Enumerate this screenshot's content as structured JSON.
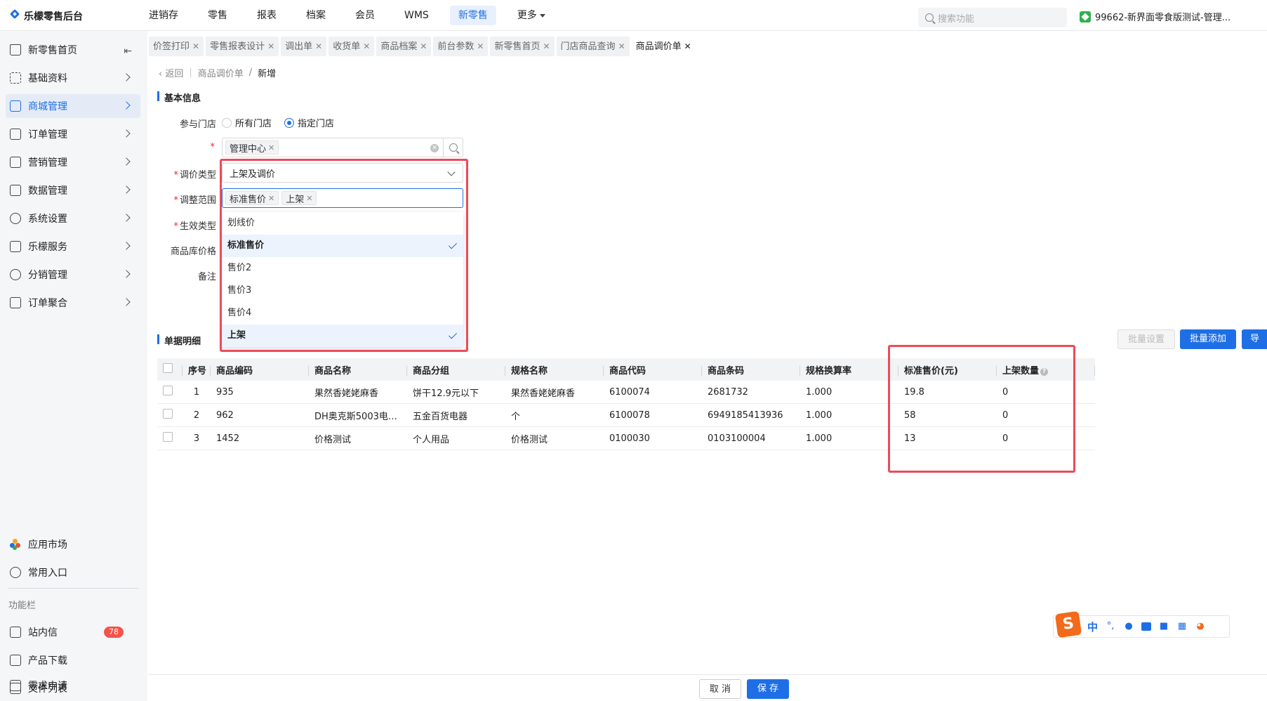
{
  "app": {
    "title": "乐檬零售后台"
  },
  "topnav": {
    "items": [
      "进销存",
      "零售",
      "报表",
      "档案",
      "会员",
      "WMS",
      "新零售"
    ],
    "more_label": "更多",
    "search_placeholder": "搜索功能",
    "store_label": "99662-新界面零食版测试-管理..."
  },
  "sidebar": {
    "items": [
      {
        "label": "新零售首页"
      },
      {
        "label": "基础资料"
      },
      {
        "label": "商城管理"
      },
      {
        "label": "订单管理"
      },
      {
        "label": "营销管理"
      },
      {
        "label": "数据管理"
      },
      {
        "label": "系统设置"
      },
      {
        "label": "乐檬服务"
      },
      {
        "label": "分销管理"
      },
      {
        "label": "订单聚合"
      }
    ],
    "bottom": {
      "app_market": "应用市场",
      "common_entry": "常用入口",
      "section_label": "功能栏",
      "inbox": "站内信",
      "inbox_badge": "78",
      "download": "产品下载",
      "files": "文件列表",
      "requests": "需求申请"
    }
  },
  "tabs": [
    {
      "label": "价签打印"
    },
    {
      "label": "零售报表设计"
    },
    {
      "label": "调出单"
    },
    {
      "label": "收货单"
    },
    {
      "label": "商品档案"
    },
    {
      "label": "前台参数"
    },
    {
      "label": "新零售首页"
    },
    {
      "label": "门店商品查询"
    },
    {
      "label": "商品调价单"
    }
  ],
  "breadcrumb": {
    "back": "返回",
    "parent": "商品调价单",
    "sep": "/",
    "current": "新增"
  },
  "basic_info": {
    "title": "基本信息",
    "store_label": "参与门店",
    "store_options": [
      "所有门店",
      "指定门店"
    ],
    "store_tag": "管理中心",
    "adjust_type_label": "调价类型",
    "adjust_type_value": "上架及调价",
    "range_label": "调整范围",
    "range_tags": [
      "标准售价",
      "上架"
    ],
    "effective_label": "生效类型",
    "price_label": "商品库价格",
    "note_label": "备注"
  },
  "dropdown": {
    "options": [
      {
        "label": "划线价",
        "selected": false
      },
      {
        "label": "标准售价",
        "selected": true
      },
      {
        "label": "售价2",
        "selected": false
      },
      {
        "label": "售价3",
        "selected": false
      },
      {
        "label": "售价4",
        "selected": false
      },
      {
        "label": "上架",
        "selected": true
      }
    ]
  },
  "details": {
    "title": "单据明细",
    "batch_set": "批量设置",
    "batch_add": "批量添加",
    "import": "导入",
    "columns": [
      "序号",
      "商品编码",
      "商品名称",
      "商品分组",
      "规格名称",
      "商品代码",
      "商品条码",
      "规格换算率",
      "标准售价(元)",
      "上架数量"
    ],
    "rows": [
      [
        "1",
        "935",
        "果然香姥姥麻香",
        "饼干12.9元以下",
        "果然香姥姥麻香",
        "6100074",
        "2681732",
        "1.000",
        "19.8",
        "0"
      ],
      [
        "2",
        "962",
        "DH奥克斯5003电…",
        "五金百货电器",
        "个",
        "6100078",
        "6949185413936",
        "1.000",
        "58",
        "0"
      ],
      [
        "3",
        "1452",
        "价格测试",
        "个人用品",
        "价格测试",
        "0100030",
        "0103100004",
        "1.000",
        "13",
        "0"
      ]
    ]
  },
  "footer": {
    "cancel": "取 消",
    "save": "保 存"
  },
  "ime": {
    "mode": "中"
  },
  "colors": {
    "accent": "#1e6fe6",
    "highlight": "#ec4a5b",
    "badge": "#f5524a"
  }
}
